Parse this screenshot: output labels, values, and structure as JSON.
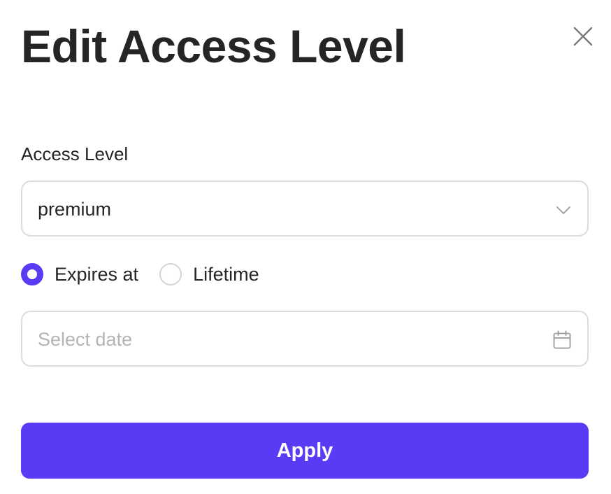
{
  "dialog": {
    "title": "Edit Access Level",
    "close_icon": "close-icon"
  },
  "access_level": {
    "label": "Access Level",
    "selected_value": "premium",
    "dropdown_icon": "chevron-down-icon"
  },
  "expiry": {
    "options": [
      {
        "label": "Expires at",
        "checked": true
      },
      {
        "label": "Lifetime",
        "checked": false
      }
    ]
  },
  "date_field": {
    "placeholder": "Select date",
    "value": "",
    "icon": "calendar-icon"
  },
  "actions": {
    "apply_label": "Apply"
  },
  "colors": {
    "accent": "#5b3af5",
    "text": "#252525",
    "border": "#dcdcdc",
    "placeholder": "#b4b4b4"
  }
}
